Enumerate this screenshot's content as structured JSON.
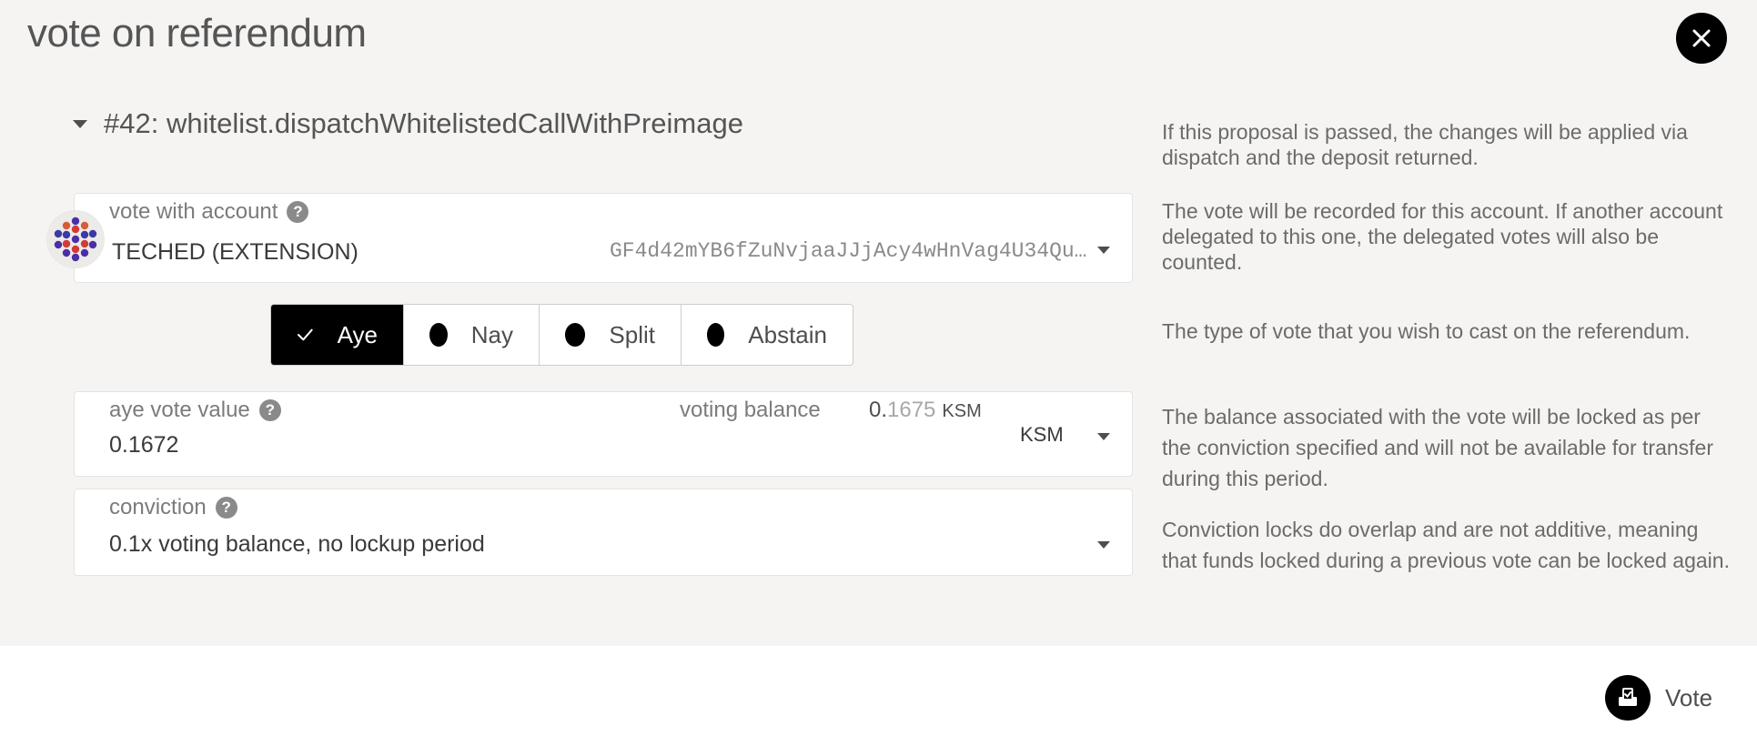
{
  "modal": {
    "title": "vote on referendum",
    "close_icon": "close-icon"
  },
  "proposal": {
    "label": "#42: whitelist.dispatchWhitelistedCallWithPreimage",
    "help": "If this proposal is passed, the changes will be applied via dispatch and the deposit returned."
  },
  "account": {
    "label": "vote with account",
    "name": "TECHED (EXTENSION)",
    "address": "GF4d42mYB6fZuNvjaaJJjAcy4wHnVag4U34Qu…",
    "help": "The vote will be recorded for this account. If another account delegated to this one, the delegated votes will also be counted."
  },
  "vote_type": {
    "options": [
      "Aye",
      "Nay",
      "Split",
      "Abstain"
    ],
    "selected": "Aye",
    "help": "The type of vote that you wish to cast on the referendum."
  },
  "vote_value": {
    "label": "aye vote value",
    "value": "0.1672",
    "balance_label": "voting balance",
    "balance_int": "0.",
    "balance_frac": "1675",
    "balance_unit": "KSM",
    "unit": "KSM",
    "help": "The balance associated with the vote will be locked as per the conviction specified and will not be available for transfer during this period."
  },
  "conviction": {
    "label": "conviction",
    "value": "0.1x voting balance, no lockup period",
    "help": "Conviction locks do overlap and are not additive, meaning that funds locked during a previous vote can be locked again."
  },
  "footer": {
    "vote_label": "Vote"
  },
  "colors": {
    "background": "#f5f4f3",
    "accent": "#000000"
  }
}
